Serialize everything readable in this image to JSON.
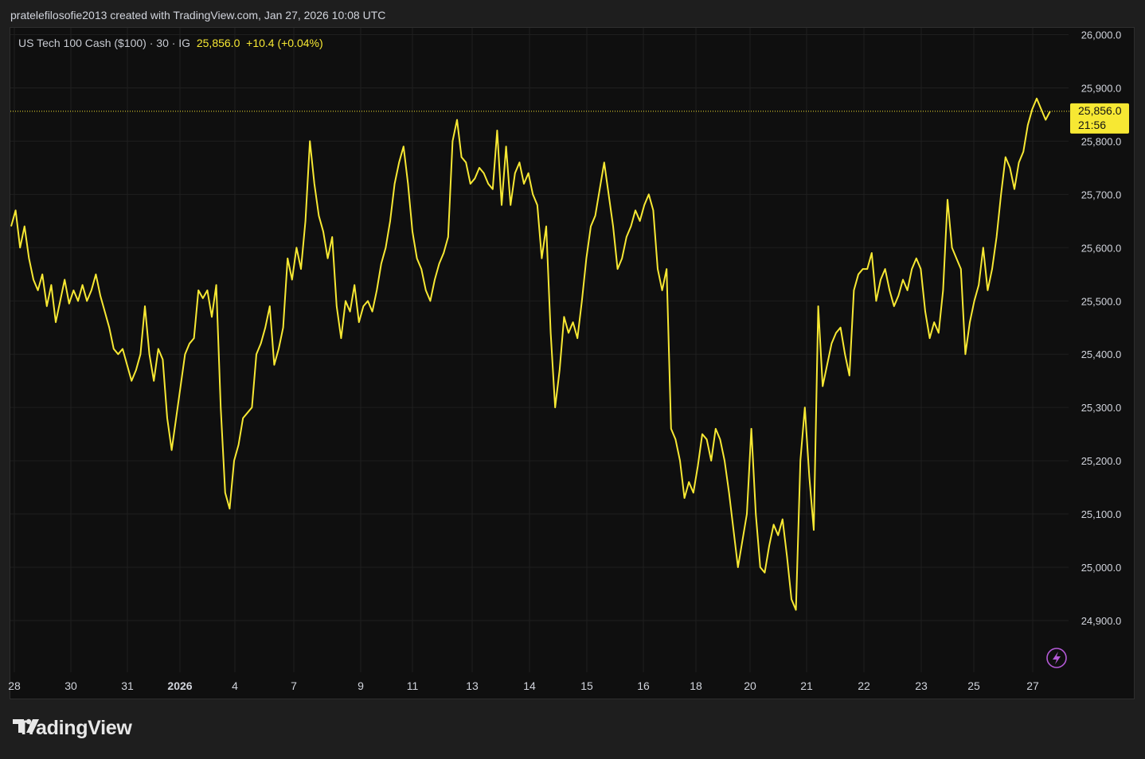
{
  "attribution": "pratelefilosofie2013 created with TradingView.com, Jan 27, 2026 10:08 UTC",
  "legend": {
    "symbol": "US Tech 100 Cash ($100) · 30 · IG",
    "last": "25,856.0",
    "change": "+10.4",
    "change_pct": "(+0.04%)"
  },
  "price_label": {
    "price": "25,856.0",
    "countdown": "21:56"
  },
  "brand": "TradingView",
  "colors": {
    "line": "#f7e833",
    "background": "#0f0f0f",
    "grid": "#1f1f1f",
    "text": "#d1d4dc",
    "lightning": "#b45ad7"
  },
  "icons": [
    "tradingview-logo-icon",
    "lightning-icon"
  ],
  "chart_data": {
    "type": "line",
    "title": "US Tech 100 Cash ($100) · 30 · IG",
    "xlabel": "",
    "ylabel": "",
    "ylim": [
      24820,
      26000
    ],
    "grid": true,
    "y_ticks": [
      "26,000.0",
      "25,900.0",
      "25,800.0",
      "25,700.0",
      "25,600.0",
      "25,500.0",
      "25,400.0",
      "25,300.0",
      "25,200.0",
      "25,100.0",
      "25,000.0",
      "24,900.0"
    ],
    "x_ticks": [
      "28",
      "30",
      "31",
      "2026",
      "4",
      "7",
      "9",
      "11",
      "13",
      "14",
      "15",
      "16",
      "18",
      "20",
      "21",
      "22",
      "23",
      "25",
      "27"
    ],
    "series": [
      {
        "points": [
          [
            0,
            25640
          ],
          [
            2,
            25670
          ],
          [
            4,
            25600
          ],
          [
            6,
            25640
          ],
          [
            8,
            25580
          ],
          [
            10,
            25540
          ],
          [
            12,
            25520
          ],
          [
            14,
            25550
          ],
          [
            16,
            25490
          ],
          [
            18,
            25530
          ],
          [
            20,
            25460
          ],
          [
            22,
            25500
          ],
          [
            24,
            25540
          ],
          [
            26,
            25495
          ],
          [
            28,
            25520
          ],
          [
            30,
            25500
          ],
          [
            32,
            25530
          ],
          [
            34,
            25500
          ],
          [
            36,
            25520
          ],
          [
            38,
            25550
          ],
          [
            40,
            25510
          ],
          [
            42,
            25480
          ],
          [
            44,
            25450
          ],
          [
            46,
            25410
          ],
          [
            48,
            25400
          ],
          [
            50,
            25410
          ],
          [
            52,
            25380
          ],
          [
            54,
            25350
          ],
          [
            56,
            25370
          ],
          [
            58,
            25400
          ],
          [
            60,
            25490
          ],
          [
            62,
            25400
          ],
          [
            64,
            25350
          ],
          [
            66,
            25410
          ],
          [
            68,
            25390
          ],
          [
            70,
            25280
          ],
          [
            72,
            25220
          ],
          [
            74,
            25280
          ],
          [
            76,
            25340
          ],
          [
            78,
            25400
          ],
          [
            80,
            25420
          ],
          [
            82,
            25430
          ],
          [
            84,
            25520
          ],
          [
            86,
            25505
          ],
          [
            88,
            25520
          ],
          [
            90,
            25470
          ],
          [
            92,
            25530
          ],
          [
            94,
            25300
          ],
          [
            96,
            25140
          ],
          [
            98,
            25110
          ],
          [
            100,
            25200
          ],
          [
            102,
            25230
          ],
          [
            104,
            25280
          ],
          [
            106,
            25290
          ],
          [
            108,
            25300
          ],
          [
            110,
            25400
          ],
          [
            112,
            25420
          ],
          [
            114,
            25450
          ],
          [
            116,
            25490
          ],
          [
            118,
            25380
          ],
          [
            120,
            25410
          ],
          [
            122,
            25450
          ],
          [
            124,
            25580
          ],
          [
            126,
            25540
          ],
          [
            128,
            25600
          ],
          [
            130,
            25560
          ],
          [
            132,
            25650
          ],
          [
            134,
            25800
          ],
          [
            136,
            25720
          ],
          [
            138,
            25660
          ],
          [
            140,
            25630
          ],
          [
            142,
            25580
          ],
          [
            144,
            25620
          ],
          [
            146,
            25490
          ],
          [
            148,
            25430
          ],
          [
            150,
            25500
          ],
          [
            152,
            25480
          ],
          [
            154,
            25530
          ],
          [
            156,
            25460
          ],
          [
            158,
            25490
          ],
          [
            160,
            25500
          ],
          [
            162,
            25480
          ],
          [
            164,
            25520
          ],
          [
            166,
            25570
          ],
          [
            168,
            25600
          ],
          [
            170,
            25650
          ],
          [
            172,
            25720
          ],
          [
            174,
            25760
          ],
          [
            176,
            25790
          ],
          [
            178,
            25720
          ],
          [
            180,
            25630
          ],
          [
            182,
            25580
          ],
          [
            184,
            25560
          ],
          [
            186,
            25520
          ],
          [
            188,
            25500
          ],
          [
            190,
            25540
          ],
          [
            192,
            25570
          ],
          [
            194,
            25590
          ],
          [
            196,
            25620
          ],
          [
            198,
            25800
          ],
          [
            200,
            25840
          ],
          [
            202,
            25770
          ],
          [
            204,
            25760
          ],
          [
            206,
            25720
          ],
          [
            208,
            25730
          ],
          [
            210,
            25750
          ],
          [
            212,
            25740
          ],
          [
            214,
            25720
          ],
          [
            216,
            25710
          ],
          [
            218,
            25820
          ],
          [
            220,
            25680
          ],
          [
            222,
            25790
          ],
          [
            224,
            25680
          ],
          [
            226,
            25740
          ],
          [
            228,
            25760
          ],
          [
            230,
            25720
          ],
          [
            232,
            25740
          ],
          [
            234,
            25700
          ],
          [
            236,
            25680
          ],
          [
            238,
            25580
          ],
          [
            240,
            25640
          ],
          [
            242,
            25440
          ],
          [
            244,
            25300
          ],
          [
            246,
            25370
          ],
          [
            248,
            25470
          ],
          [
            250,
            25440
          ],
          [
            252,
            25460
          ],
          [
            254,
            25430
          ],
          [
            256,
            25500
          ],
          [
            258,
            25580
          ],
          [
            260,
            25640
          ],
          [
            262,
            25660
          ],
          [
            264,
            25710
          ],
          [
            266,
            25760
          ],
          [
            268,
            25700
          ],
          [
            270,
            25640
          ],
          [
            272,
            25560
          ],
          [
            274,
            25580
          ],
          [
            276,
            25620
          ],
          [
            278,
            25640
          ],
          [
            280,
            25670
          ],
          [
            282,
            25650
          ],
          [
            284,
            25680
          ],
          [
            286,
            25700
          ],
          [
            288,
            25670
          ],
          [
            290,
            25560
          ],
          [
            292,
            25520
          ],
          [
            294,
            25560
          ],
          [
            296,
            25260
          ],
          [
            298,
            25240
          ],
          [
            300,
            25200
          ],
          [
            302,
            25130
          ],
          [
            304,
            25160
          ],
          [
            306,
            25140
          ],
          [
            308,
            25190
          ],
          [
            310,
            25250
          ],
          [
            312,
            25240
          ],
          [
            314,
            25200
          ],
          [
            316,
            25260
          ],
          [
            318,
            25240
          ],
          [
            320,
            25200
          ],
          [
            322,
            25140
          ],
          [
            324,
            25070
          ],
          [
            326,
            25000
          ],
          [
            328,
            25050
          ],
          [
            330,
            25100
          ],
          [
            332,
            25260
          ],
          [
            334,
            25100
          ],
          [
            336,
            25000
          ],
          [
            338,
            24990
          ],
          [
            340,
            25040
          ],
          [
            342,
            25080
          ],
          [
            344,
            25060
          ],
          [
            346,
            25090
          ],
          [
            348,
            25020
          ],
          [
            350,
            24940
          ],
          [
            352,
            24920
          ],
          [
            354,
            25200
          ],
          [
            356,
            25300
          ],
          [
            358,
            25170
          ],
          [
            360,
            25070
          ],
          [
            362,
            25490
          ],
          [
            364,
            25340
          ],
          [
            366,
            25380
          ],
          [
            368,
            25420
          ],
          [
            370,
            25440
          ],
          [
            372,
            25450
          ],
          [
            374,
            25400
          ],
          [
            376,
            25360
          ],
          [
            378,
            25520
          ],
          [
            380,
            25550
          ],
          [
            382,
            25560
          ],
          [
            384,
            25560
          ],
          [
            386,
            25590
          ],
          [
            388,
            25500
          ],
          [
            390,
            25540
          ],
          [
            392,
            25560
          ],
          [
            394,
            25520
          ],
          [
            396,
            25490
          ],
          [
            398,
            25510
          ],
          [
            400,
            25540
          ],
          [
            402,
            25520
          ],
          [
            404,
            25560
          ],
          [
            406,
            25580
          ],
          [
            408,
            25560
          ],
          [
            410,
            25480
          ],
          [
            412,
            25430
          ],
          [
            414,
            25460
          ],
          [
            416,
            25440
          ],
          [
            418,
            25520
          ],
          [
            420,
            25690
          ],
          [
            422,
            25600
          ],
          [
            424,
            25580
          ],
          [
            426,
            25560
          ],
          [
            428,
            25400
          ],
          [
            430,
            25460
          ],
          [
            432,
            25500
          ],
          [
            434,
            25530
          ],
          [
            436,
            25600
          ],
          [
            438,
            25520
          ],
          [
            440,
            25560
          ],
          [
            442,
            25620
          ],
          [
            444,
            25700
          ],
          [
            446,
            25770
          ],
          [
            448,
            25750
          ],
          [
            450,
            25710
          ],
          [
            452,
            25760
          ],
          [
            454,
            25780
          ],
          [
            456,
            25830
          ],
          [
            458,
            25860
          ],
          [
            460,
            25880
          ],
          [
            462,
            25860
          ],
          [
            464,
            25840
          ],
          [
            466,
            25856
          ]
        ]
      }
    ]
  }
}
